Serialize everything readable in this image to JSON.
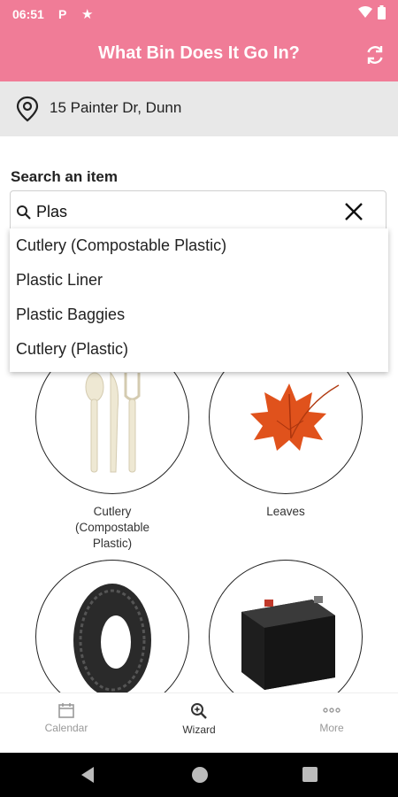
{
  "status_bar": {
    "time": "06:51",
    "p_icon": "P",
    "star_icon": "★"
  },
  "header": {
    "title": "What Bin Does It Go In?",
    "refresh_icon": "refresh-icon"
  },
  "address": {
    "text": "15 Painter Dr, Dunn"
  },
  "search": {
    "label": "Search an item",
    "value": "Plas",
    "suggestions": [
      "Cutlery (Compostable Plastic)",
      "Plastic Liner",
      "Plastic Baggies",
      "Cutlery (Plastic)"
    ]
  },
  "items": [
    {
      "label": "Cutlery\n(Compostable\nPlastic)"
    },
    {
      "label": "Leaves"
    }
  ],
  "bottom_nav": {
    "items": [
      {
        "label": "Calendar",
        "icon": "calendar-icon"
      },
      {
        "label": "Wizard",
        "icon": "wizard-icon",
        "active": true
      },
      {
        "label": "More",
        "icon": "more-icon"
      }
    ]
  },
  "colors": {
    "brand": "#f07c97",
    "address_bg": "#e8e8e8"
  }
}
